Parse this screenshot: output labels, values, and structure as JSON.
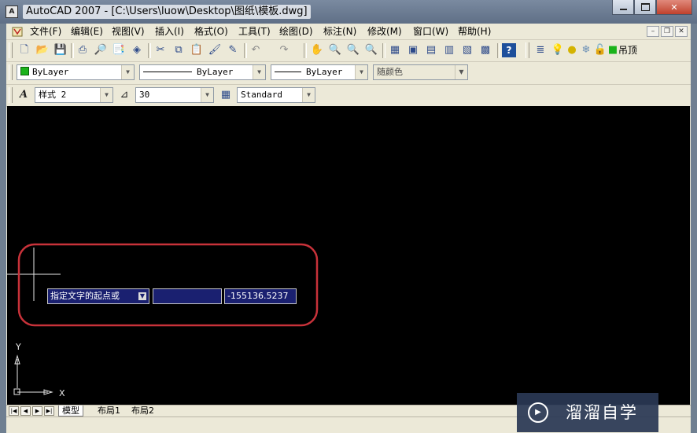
{
  "window": {
    "title": "AutoCAD 2007 - [C:\\Users\\luow\\Desktop\\图纸\\模板.dwg]",
    "icon_label": "A",
    "minimize_icon": "minimize-icon",
    "maximize_icon": "maximize-icon",
    "close_glyph": "✕"
  },
  "menubar": {
    "items": [
      "文件(F)",
      "编辑(E)",
      "视图(V)",
      "插入(I)",
      "格式(O)",
      "工具(T)",
      "绘图(D)",
      "标注(N)",
      "修改(M)",
      "窗口(W)",
      "帮助(H)"
    ],
    "mdi_min": "–",
    "mdi_restore": "❐",
    "mdi_close": "✕"
  },
  "standard_toolbar": {
    "icons": [
      "new-icon",
      "open-icon",
      "save-icon",
      "print-icon",
      "plot-preview-icon",
      "publish-icon",
      "3d-dwf-icon",
      "cut-icon",
      "copy-icon",
      "paste-icon",
      "match-properties-icon",
      "block-editor-icon",
      "undo-icon",
      "redo-icon",
      "pan-icon",
      "zoom-realtime-icon",
      "zoom-window-icon",
      "zoom-previous-icon",
      "properties-icon",
      "design-center-icon",
      "tool-palettes-icon",
      "sheet-set-icon",
      "markup-icon",
      "calculator-icon",
      "help-icon"
    ],
    "layer_label": "吊顶"
  },
  "properties_toolbar": {
    "color": "ByLayer",
    "linetype": "ByLayer",
    "lineweight": "ByLayer",
    "plot_style": "随颜色",
    "color_swatch": "#1bb31b"
  },
  "styles_toolbar": {
    "text_style": "样式 2",
    "dim_style": "30",
    "table_style": "Standard"
  },
  "canvas": {
    "background": "#000000",
    "annotation_color": "#c8323a",
    "prompt": "指定文字的起点或",
    "input_value": "",
    "coordinate_value": "-155136.5237",
    "ucs_x_label": "X",
    "ucs_y_label": "Y"
  },
  "layout_tabs": {
    "tabs": [
      "模型",
      "布局1",
      "布局2"
    ],
    "active": "模型"
  },
  "watermark": {
    "text": "溜溜自学",
    "icon": "play-icon"
  }
}
